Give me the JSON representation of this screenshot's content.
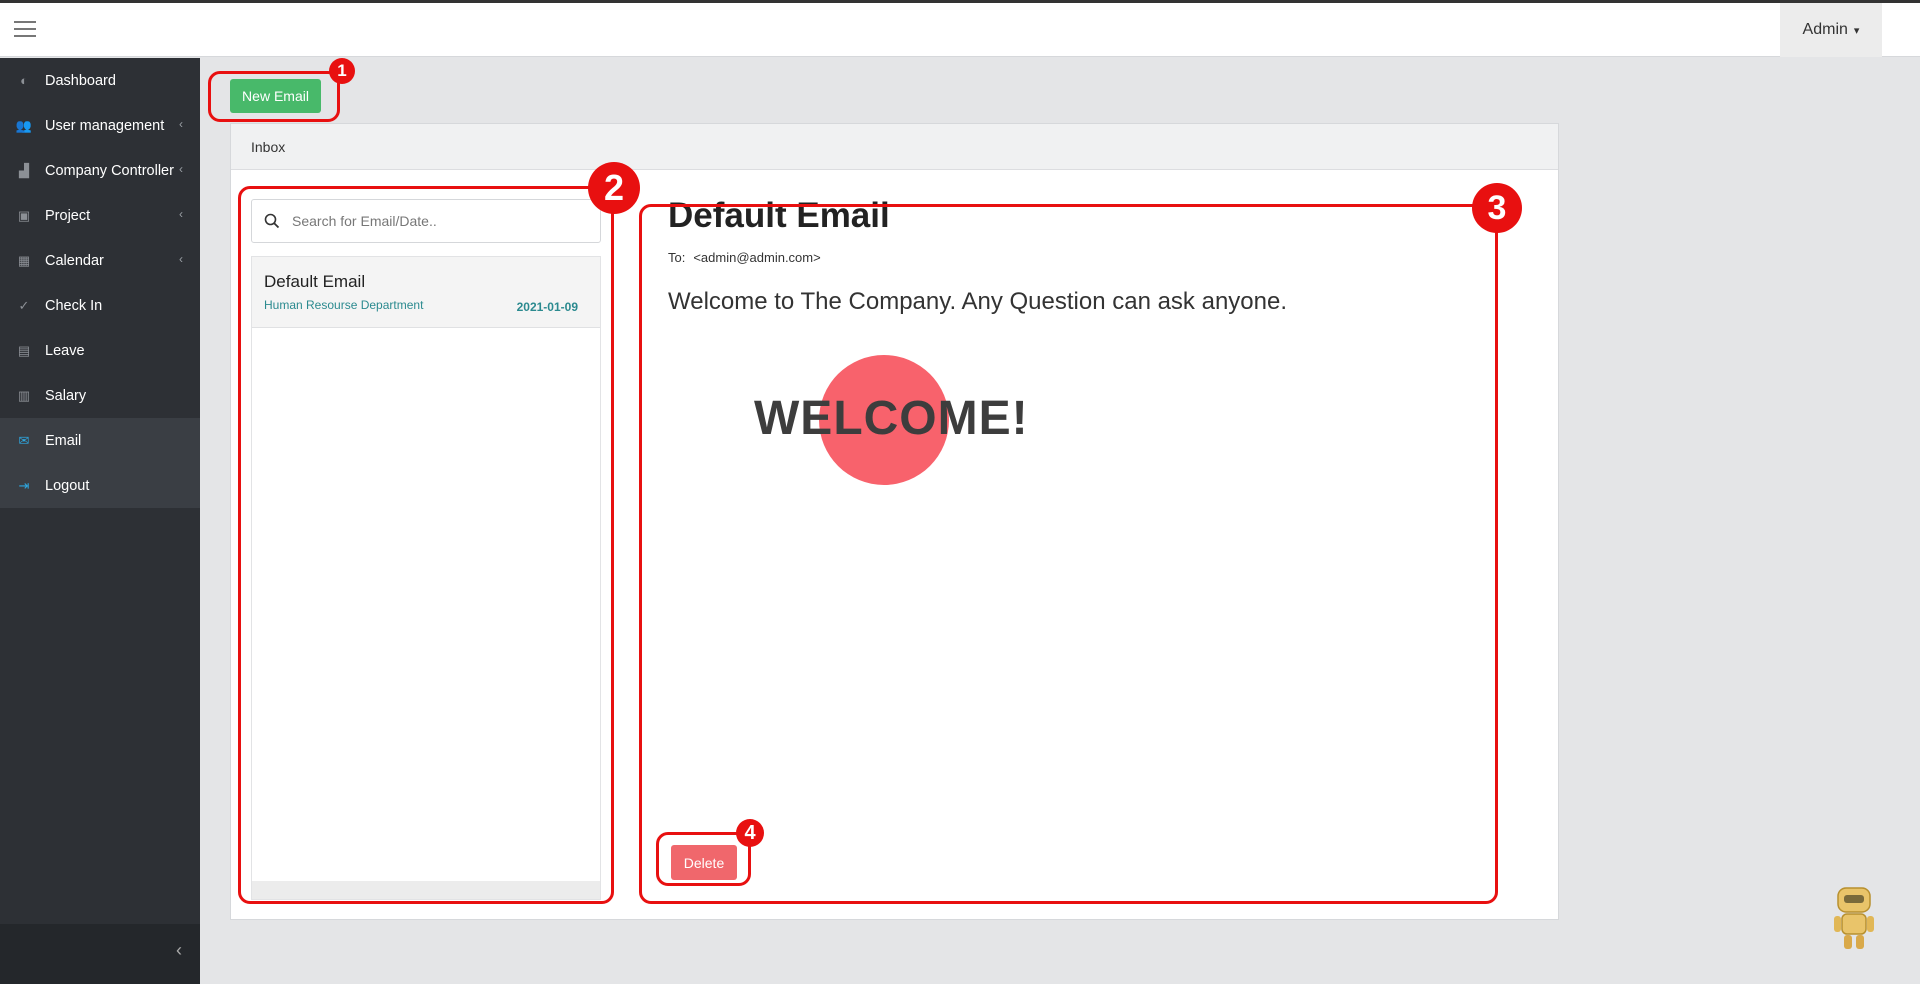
{
  "topbar": {
    "user_menu": "Admin",
    "caret": "▾"
  },
  "sidebar": {
    "items": [
      {
        "label": "Dashboard",
        "icon": "dashboard-icon",
        "glyph": "◐",
        "chevron": ""
      },
      {
        "label": "User management",
        "icon": "users-icon",
        "glyph": "👥",
        "chevron": "‹"
      },
      {
        "label": "Company Controller",
        "icon": "chart-icon",
        "glyph": "▟",
        "chevron": "‹"
      },
      {
        "label": "Project",
        "icon": "project-icon",
        "glyph": "▣",
        "chevron": "‹"
      },
      {
        "label": "Calendar",
        "icon": "calendar-icon",
        "glyph": "▦",
        "chevron": "‹"
      },
      {
        "label": "Check In",
        "icon": "check-icon",
        "glyph": "✓",
        "chevron": ""
      },
      {
        "label": "Leave",
        "icon": "leave-icon",
        "glyph": "▤",
        "chevron": ""
      },
      {
        "label": "Salary",
        "icon": "salary-icon",
        "glyph": "▥",
        "chevron": ""
      },
      {
        "label": "Email",
        "icon": "email-icon",
        "glyph": "✉",
        "chevron": ""
      },
      {
        "label": "Logout",
        "icon": "logout-icon",
        "glyph": "⇥",
        "chevron": ""
      }
    ],
    "collapse_glyph": "‹"
  },
  "toolbar": {
    "new_email_label": "New Email"
  },
  "inbox": {
    "header": "Inbox",
    "search_placeholder": "Search for Email/Date..",
    "emails": [
      {
        "subject": "Default Email",
        "department": "Human Resourse Department",
        "date": "2021-01-09"
      }
    ]
  },
  "detail": {
    "subject": "Default Email",
    "to_label": "To:",
    "to_address": "<admin@admin.com>",
    "body": "Welcome to The Company. Any Question can ask anyone.",
    "image_text": "WELCOME!",
    "delete_label": "Delete"
  },
  "annotations": {
    "one": "1",
    "two": "2",
    "three": "3",
    "four": "4"
  },
  "colors": {
    "accent_green": "#48b96a",
    "danger": "#f0676c",
    "annotation_red": "#e81010",
    "sidebar_bg": "#2d3035",
    "link_teal": "#2b8a8f"
  }
}
